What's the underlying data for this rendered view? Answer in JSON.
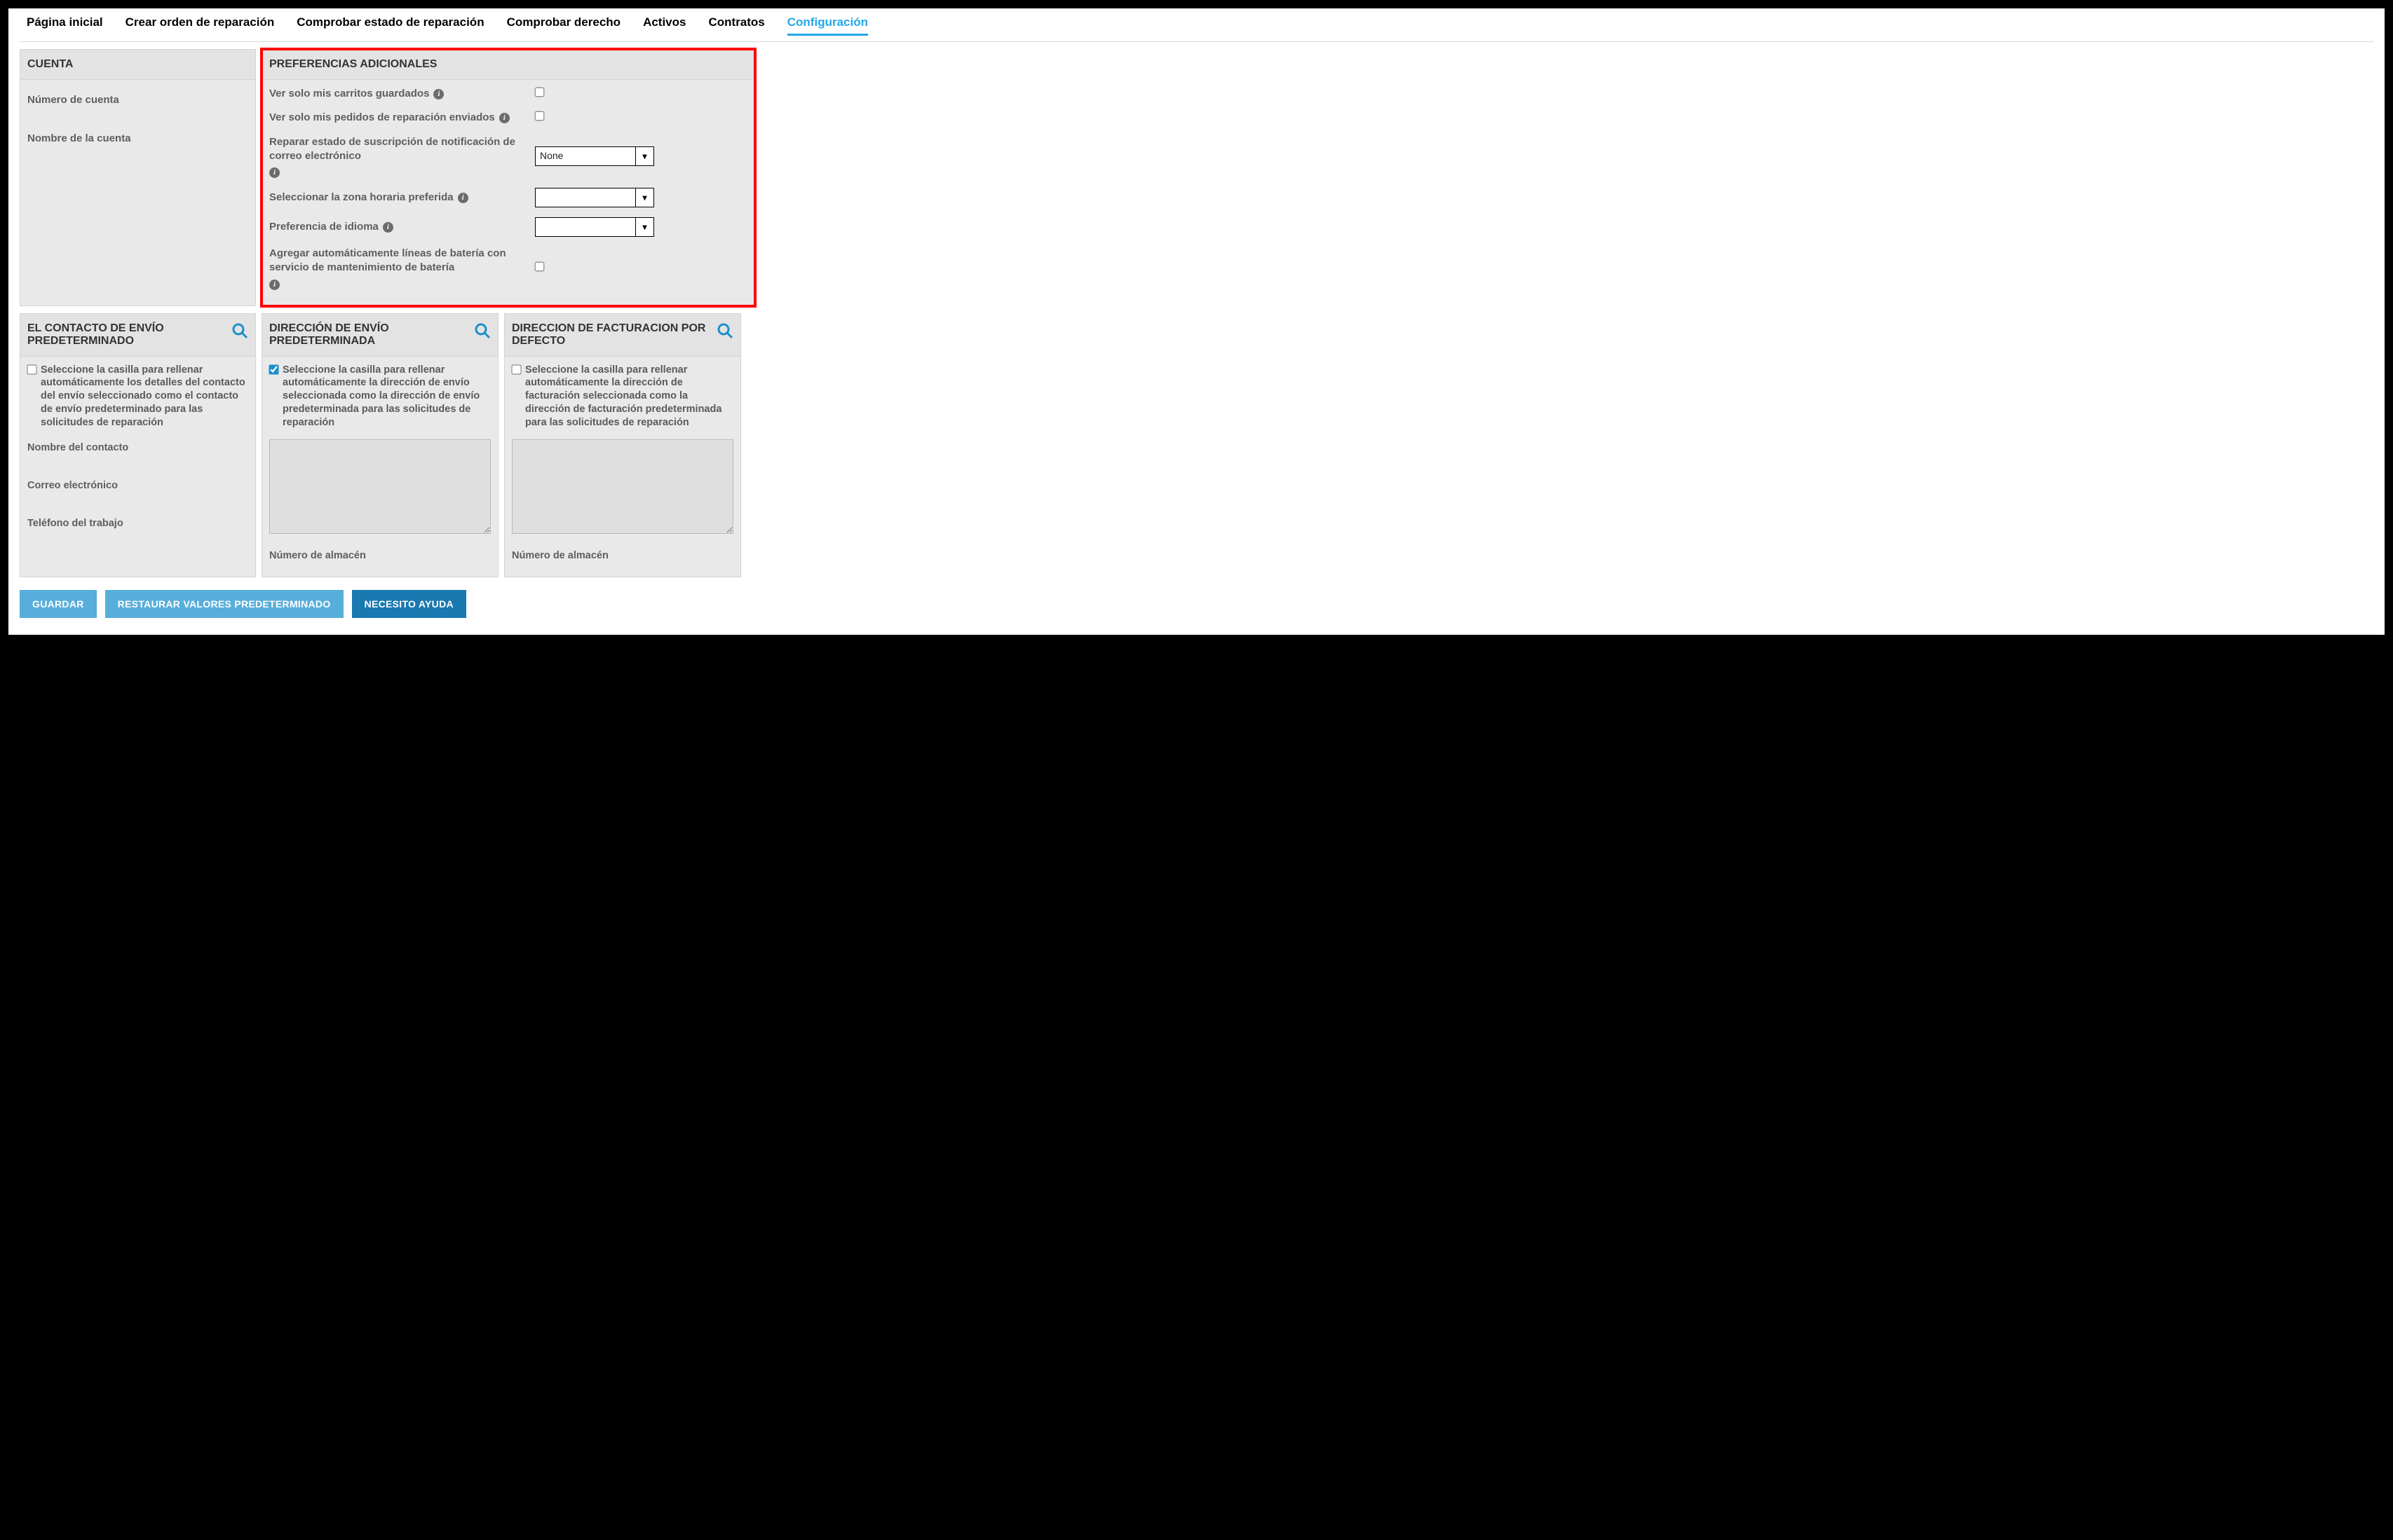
{
  "tabs": [
    {
      "label": "Página inicial",
      "active": false
    },
    {
      "label": "Crear orden de reparación",
      "active": false
    },
    {
      "label": "Comprobar estado de reparación",
      "active": false
    },
    {
      "label": "Comprobar derecho",
      "active": false
    },
    {
      "label": "Activos",
      "active": false
    },
    {
      "label": "Contratos",
      "active": false
    },
    {
      "label": "Configuración",
      "active": true
    }
  ],
  "account": {
    "header": "CUENTA",
    "rows": [
      {
        "label": "Número de cuenta"
      },
      {
        "label": "Nombre de la cuenta"
      }
    ]
  },
  "prefs": {
    "header": "PREFERENCIAS ADICIONALES",
    "rows": [
      {
        "label": "Ver solo mis carritos guardados",
        "type": "checkbox",
        "checked": false
      },
      {
        "label": "Ver solo mis pedidos de reparación enviados",
        "type": "checkbox",
        "checked": false
      },
      {
        "label": "Reparar estado de suscripción de notificación de correo electrónico",
        "type": "select",
        "value": "None"
      },
      {
        "label": "Seleccionar la zona horaria preferida",
        "type": "select",
        "value": ""
      },
      {
        "label": "Preferencia de idioma",
        "type": "select",
        "value": ""
      },
      {
        "label": "Agregar automáticamente líneas de batería con servicio de mantenimiento de batería",
        "type": "checkbox",
        "checked": false
      }
    ]
  },
  "contact": {
    "header": "EL CONTACTO DE ENVÍO PREDETERMINADO",
    "checkbox_label": "Seleccione la casilla para rellenar automáticamente los detalles del contacto del envío seleccionado como el contacto de envío predeterminado para las solicitudes de reparación",
    "checked": false,
    "fields": [
      {
        "label": "Nombre del contacto"
      },
      {
        "label": "Correo electrónico"
      },
      {
        "label": "Teléfono del trabajo"
      }
    ]
  },
  "ship": {
    "header": "DIRECCIÓN DE ENVÍO PREDETERMINADA",
    "checkbox_label": "Seleccione la casilla para rellenar automáticamente la dirección de envío seleccionada como la dirección de envío predeterminada para las solicitudes de reparación",
    "checked": true,
    "warehouse_label": "Número de almacén"
  },
  "bill": {
    "header": "DIRECCION DE FACTURACION POR DEFECTO",
    "checkbox_label": "Seleccione la casilla para rellenar automáticamente la dirección de facturación seleccionada como la dirección de facturación predeterminada para las solicitudes de reparación",
    "checked": false,
    "warehouse_label": "Número de almacén"
  },
  "buttons": {
    "save": "GUARDAR",
    "restore": "RESTAURAR VALORES PREDETERMINADO",
    "help": "NECESITO AYUDA"
  },
  "icons": {
    "info_glyph": "i"
  }
}
